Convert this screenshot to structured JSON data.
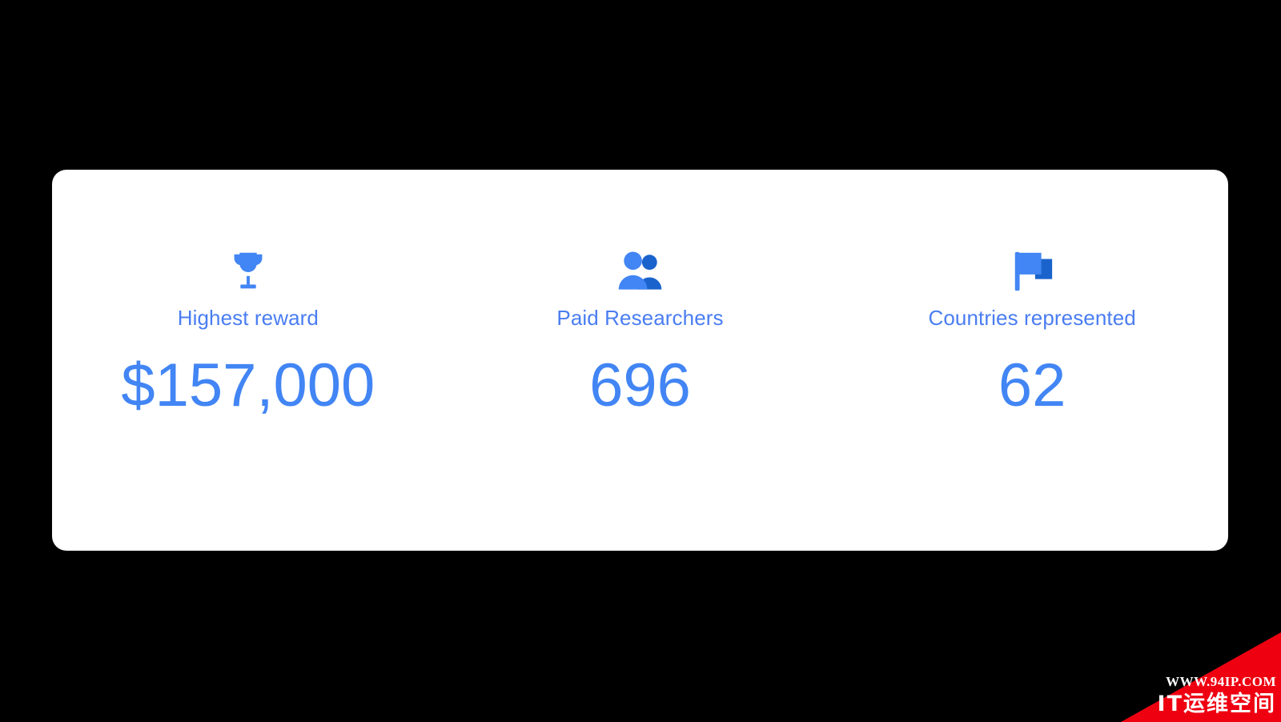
{
  "background_color": "#000000",
  "card": {
    "background_color": "#ffffff",
    "stats": [
      {
        "icon": "trophy-icon",
        "label": "Highest reward",
        "value": "$157,000",
        "label_color": "#4a7df2",
        "value_color": "#4285f4"
      },
      {
        "icon": "people-icon",
        "label": "Paid Researchers",
        "value": "696",
        "label_color": "#4a7df2",
        "value_color": "#4285f4"
      },
      {
        "icon": "flag-icon",
        "label": "Countries represented",
        "value": "62",
        "label_color": "#4a7df2",
        "value_color": "#4285f4"
      }
    ]
  },
  "icon_colors": {
    "primary": "#4285f4",
    "secondary": "#1a63cc"
  },
  "watermark": {
    "url": "WWW.94IP.COM",
    "name": "IT运维空间",
    "color": "#ee0011",
    "text_color": "#ffffff"
  }
}
